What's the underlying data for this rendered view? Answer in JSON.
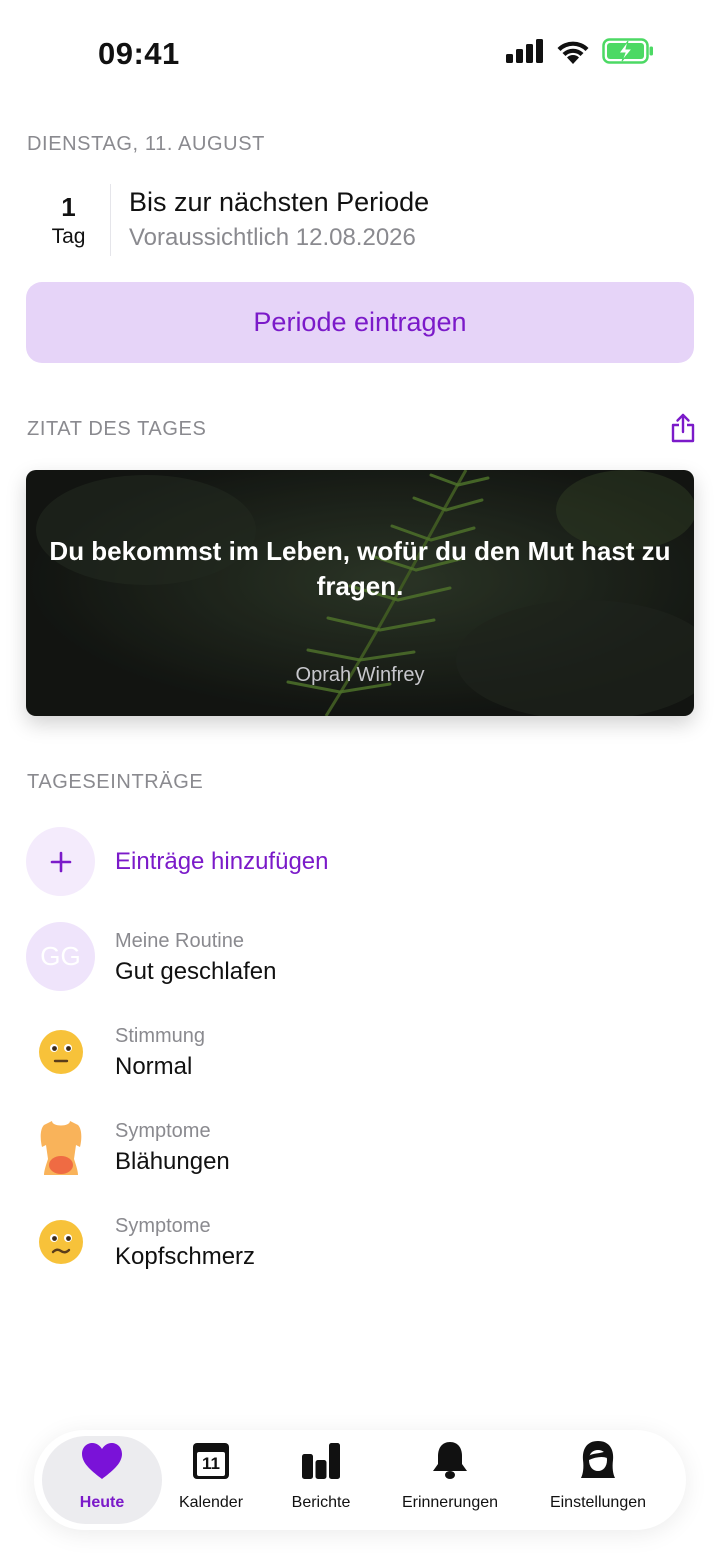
{
  "status_bar": {
    "time": "09:41"
  },
  "date_header": "DIENSTAG, 11. AUGUST",
  "countdown": {
    "number": "1",
    "unit": "Tag",
    "title": "Bis zur nächsten Periode",
    "subtitle": "Voraussichtlich 12.08.2026"
  },
  "primary_button": "Periode eintragen",
  "quote_section": {
    "label": "ZITAT DES TAGES",
    "text": "Du bekommst im Leben, wofür du den Mut hast zu fragen.",
    "author": "Oprah Winfrey"
  },
  "entries_section": {
    "label": "TAGESEINTRÄGE",
    "add_label": "Einträge hinzufügen",
    "items": [
      {
        "category": "Meine Routine",
        "value": "Gut geschlafen",
        "initials": "GG",
        "icon": "initials-avatar"
      },
      {
        "category": "Stimmung",
        "value": "Normal",
        "icon": "neutral-face-icon"
      },
      {
        "category": "Symptome",
        "value": "Blähungen",
        "icon": "torso-icon"
      },
      {
        "category": "Symptome",
        "value": "Kopfschmerz",
        "icon": "pained-face-icon"
      }
    ]
  },
  "tab_bar": {
    "tabs": [
      {
        "label": "Heute",
        "icon": "heart-icon",
        "active": true
      },
      {
        "label": "Kalender",
        "icon": "calendar-icon",
        "badge": "11"
      },
      {
        "label": "Berichte",
        "icon": "bar-chart-icon"
      },
      {
        "label": "Erinnerungen",
        "icon": "bell-icon"
      },
      {
        "label": "Einstellungen",
        "icon": "profile-icon"
      }
    ]
  },
  "colors": {
    "accent": "#7b1ac9",
    "accent_light": "#e6d4f8",
    "secondary_text": "#8a8a8f",
    "battery_green": "#4cd964"
  }
}
